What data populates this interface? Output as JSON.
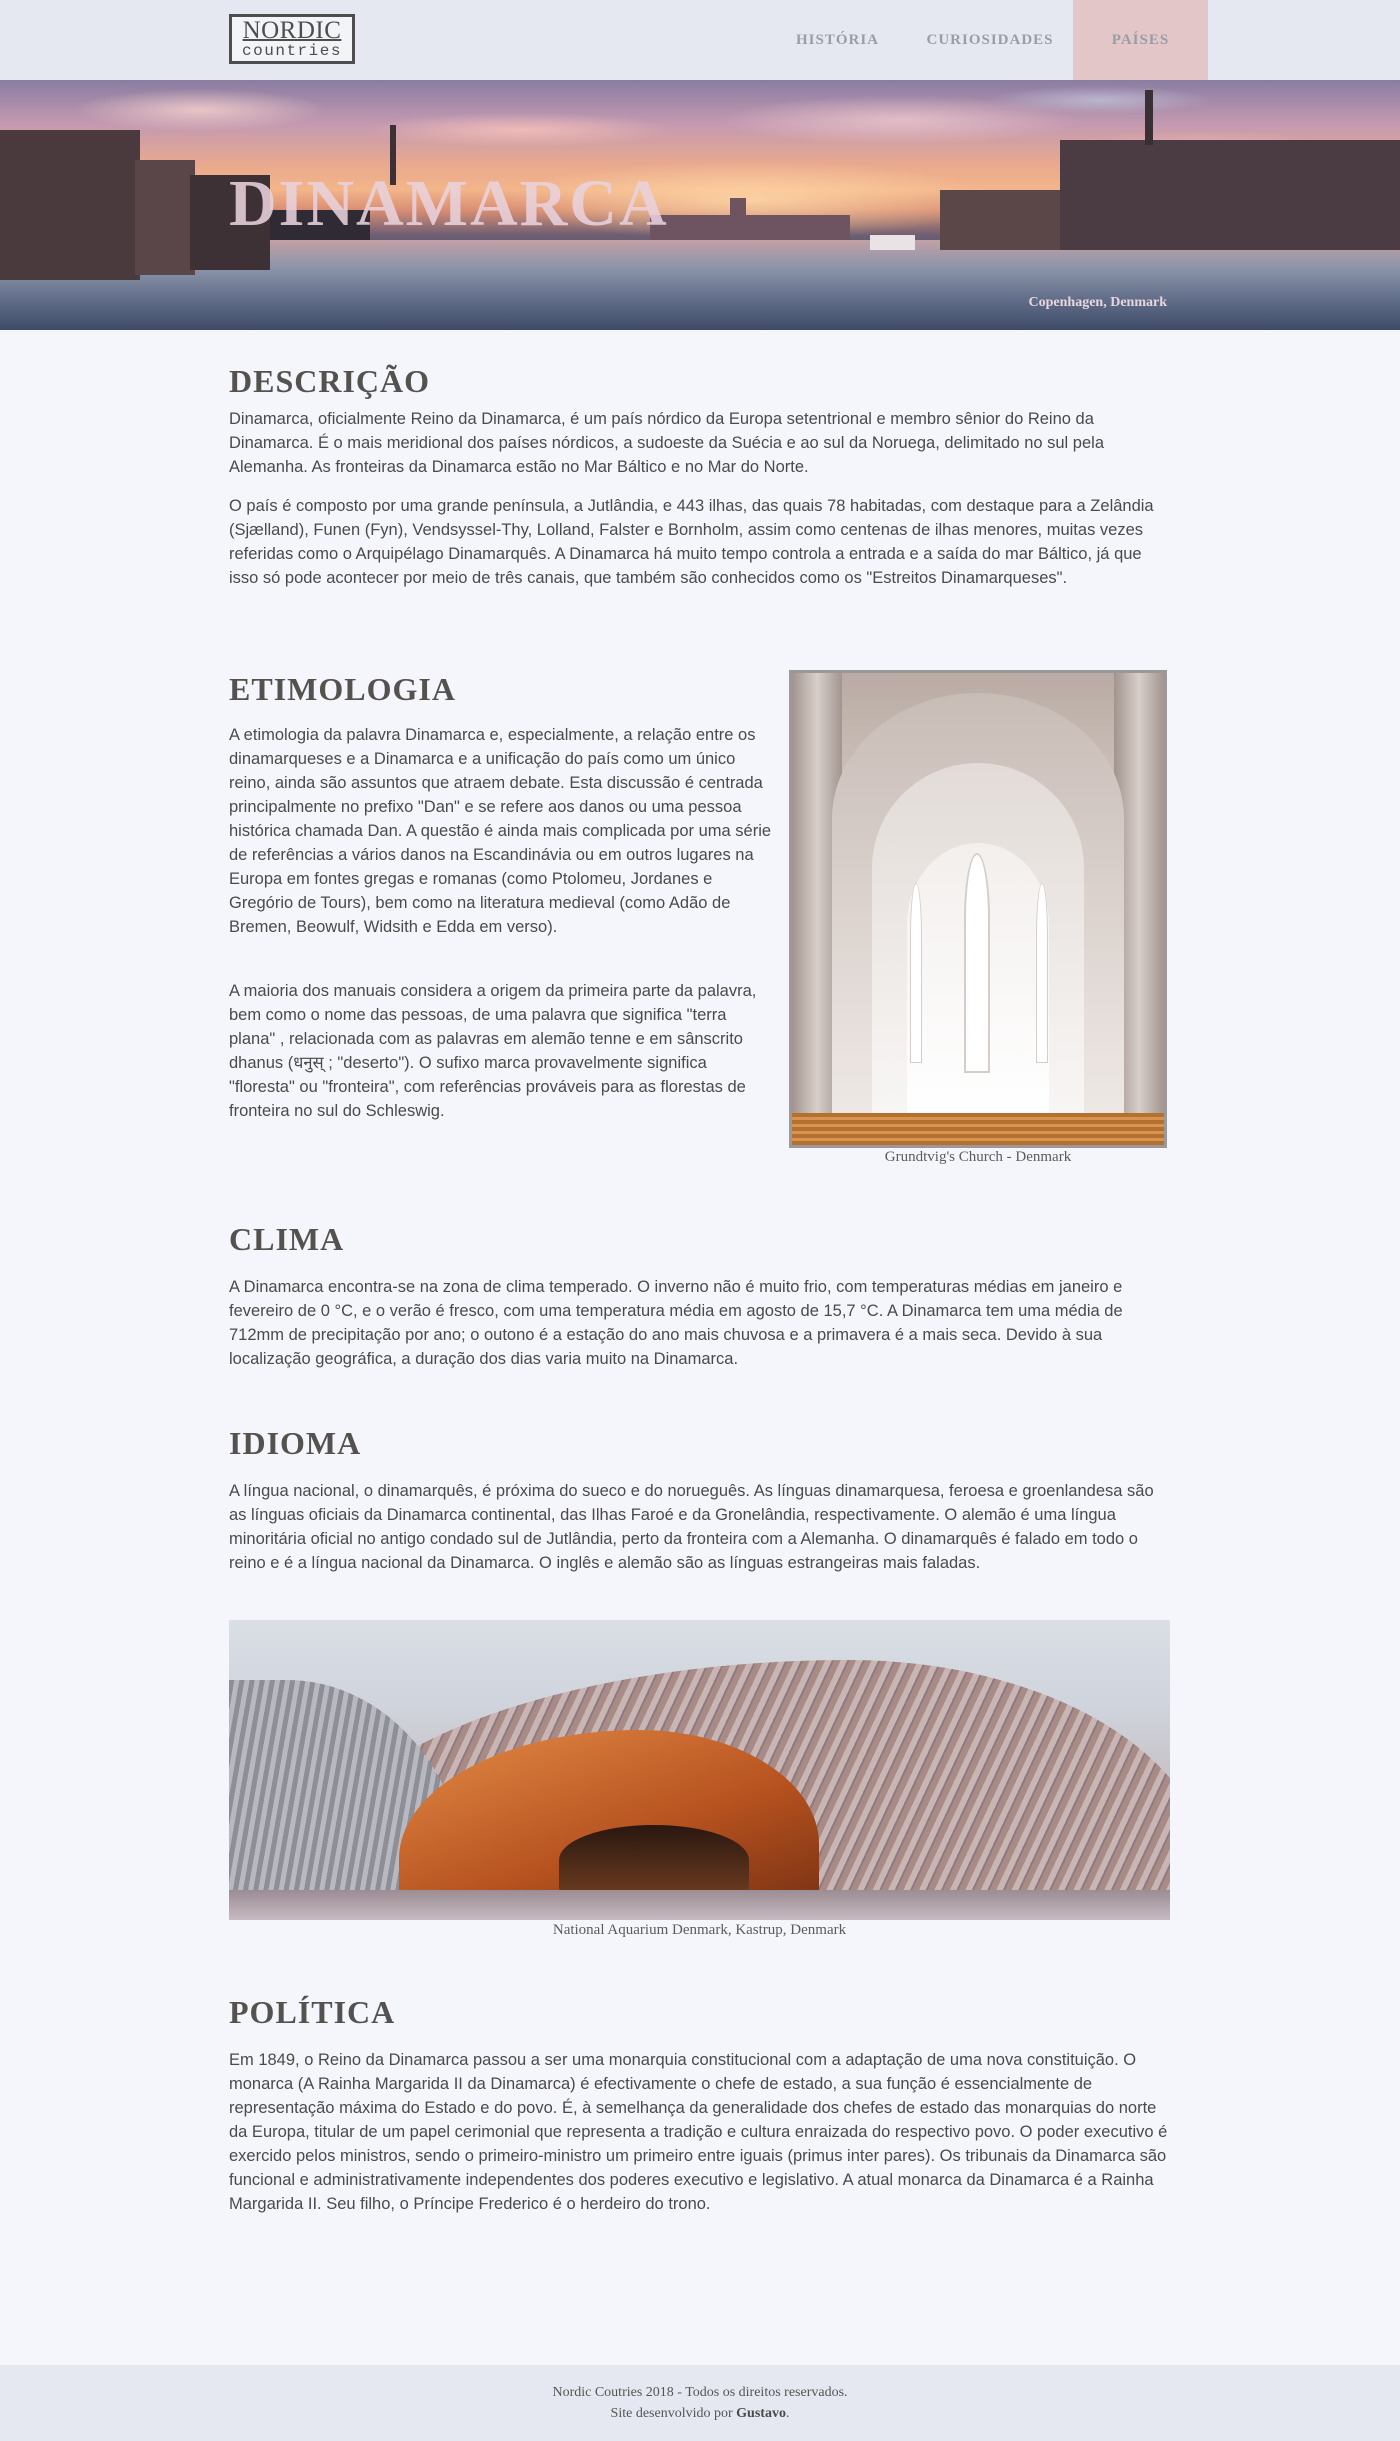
{
  "header": {
    "logo_line1": "NORDIC",
    "logo_line2": "countries",
    "nav": [
      {
        "label": "HISTÓRIA"
      },
      {
        "label": "CURIOSIDADES"
      },
      {
        "label": "PAÍSES"
      }
    ]
  },
  "hero": {
    "title": "DINAMARCA",
    "caption": "Copenhagen, Denmark"
  },
  "sections": {
    "descricao": {
      "title": "DESCRIÇÃO",
      "paragraphs": [
        "Dinamarca, oficialmente Reino da Dinamarca, é um país nórdico da Europa setentrional e membro sênior do Reino da Dinamarca. É o mais meridional dos países nórdicos, a sudoeste da Suécia e ao sul da Noruega, delimitado no sul pela Alemanha. As fronteiras da Dinamarca estão no Mar Báltico e no Mar do Norte.",
        "O país é composto por uma grande península, a Jutlândia, e 443 ilhas, das quais 78 habitadas, com destaque para a Zelândia (Sjælland), Funen (Fyn), Vendsyssel-Thy, Lolland, Falster e Bornholm, assim como centenas de ilhas menores, muitas vezes referidas como o Arquipélago Dinamarquês. A Dinamarca há muito tempo controla a entrada e a saída do mar Báltico, já que isso só pode acontecer por meio de três canais, que também são conhecidos como os \"Estreitos Dinamarqueses\"."
      ]
    },
    "etimologia": {
      "title": "ETIMOLOGIA",
      "paragraphs": [
        "A etimologia da palavra Dinamarca e, especialmente, a relação entre os dinamarqueses e a Dinamarca e a unificação do país como um único reino, ainda são assuntos que atraem debate. Esta discussão é centrada principalmente no prefixo \"Dan\" e se refere aos danos ou uma pessoa histórica chamada Dan. A questão é ainda mais complicada por uma série de referências a vários danos na Escandinávia ou em outros lugares na Europa em fontes gregas e romanas (como Ptolomeu, Jordanes e Gregório de Tours), bem como na literatura medieval (como Adão de Bremen, Beowulf, Widsith e Edda em verso).",
        "A maioria dos manuais considera a origem da primeira parte da palavra, bem como o nome das pessoas, de uma palavra que significa \"terra plana\" , relacionada com as palavras em alemão tenne e em sânscrito dhanus (धनुस् ; \"deserto\"). O sufixo marca provavelmente significa \"floresta\" ou \"fronteira\", com referências prováveis para as florestas de fronteira no sul do Schleswig."
      ],
      "image_caption": "Grundtvig's Church - Denmark"
    },
    "clima": {
      "title": "CLIMA",
      "paragraphs": [
        "A Dinamarca encontra-se na zona de clima temperado. O inverno não é muito frio, com temperaturas médias em janeiro e fevereiro de 0 °C, e o verão é fresco, com uma temperatura média em agosto de 15,7 °C. A Dinamarca tem uma média de 712mm de precipitação por ano; o outono é a estação do ano mais chuvosa e a primavera é a mais seca. Devido à sua localização geográfica, a duração dos dias varia muito na Dinamarca."
      ]
    },
    "idioma": {
      "title": "IDIOMA",
      "paragraphs": [
        "A língua nacional, o dinamarquês, é próxima do sueco e do norueguês. As línguas dinamarquesa, feroesa e groenlandesa são as línguas oficiais da Dinamarca continental, das Ilhas Faroé e da Gronelândia, respectivamente. O alemão é uma língua minoritária oficial no antigo condado sul de Jutlândia, perto da fronteira com a Alemanha. O dinamarquês é falado em todo o reino e é a língua nacional da Dinamarca. O inglês e alemão são as línguas estrangeiras mais faladas."
      ],
      "image_caption": "National Aquarium Denmark, Kastrup, Denmark"
    },
    "politica": {
      "title": "POLÍTICA",
      "paragraphs": [
        "Em 1849, o Reino da Dinamarca passou a ser uma monarquia constitucional com a adaptação de uma nova constituição. O monarca (A Rainha Margarida II da Dinamarca) é efectivamente o chefe de estado, a sua função é essencialmente de representação máxima do Estado e do povo. É, à semelhança da generalidade dos chefes de estado das monarquias do norte da Europa, titular de um papel cerimonial que representa a tradição e cultura enraizada do respectivo povo. O poder executivo é exercido pelos ministros, sendo o primeiro-ministro um primeiro entre iguais (primus inter pares). Os tribunais da Dinamarca são funcional e administrativamente independentes dos poderes executivo e legislativo. A atual monarca da Dinamarca é a Rainha Margarida II. Seu filho, o Príncipe Frederico é o herdeiro do trono."
      ]
    }
  },
  "footer": {
    "line1": "Nordic Coutries 2018 - Todos os direitos reservados.",
    "line2_prefix": "Site desenvolvido por ",
    "author": "Gustavo",
    "line2_suffix": "."
  }
}
